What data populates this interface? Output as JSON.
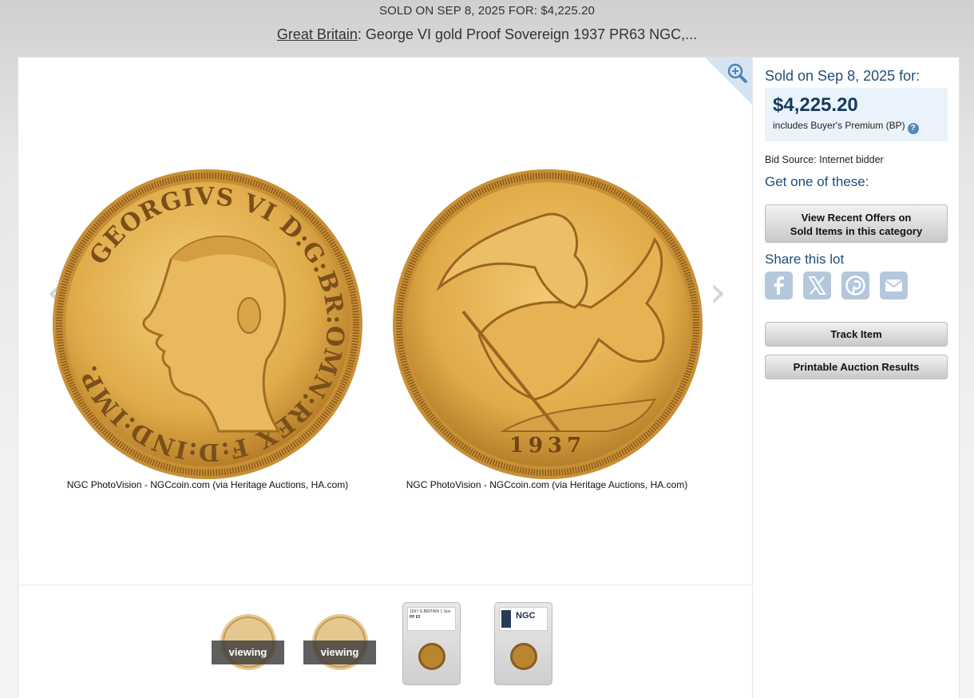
{
  "header": {
    "sold_line": "SOLD ON SEP 8, 2025 FOR: $4,225.20",
    "title_link": "Great Britain",
    "title_rest": ": George VI gold Proof Sovereign 1937 PR63 NGC,..."
  },
  "viewer": {
    "captions": [
      "NGC PhotoVision - NGCcoin.com (via Heritage Auctions, HA.com)",
      "NGC PhotoVision - NGCcoin.com (via Heritage Auctions, HA.com)"
    ],
    "obverse_legend": "GEORGIVS VI D:G:BR:OMN:REX F:D:IND:IMP.",
    "reverse_date": "1937",
    "prev_glyph": "‹",
    "next_glyph": "›"
  },
  "thumbnails": {
    "viewing_label": "viewing",
    "slab_label_1": "1937 G.BRITAIN 1 Sov",
    "slab_grade_1": "PF 63",
    "slab_label_2": "NGC"
  },
  "sidebar": {
    "sold_on": "Sold on Sep 8, 2025 for:",
    "price": "$4,225.20",
    "bp_note": "includes Buyer's Premium (BP)",
    "help": "?",
    "bid_source": "Bid Source: Internet bidder",
    "get_one": "Get one of these:",
    "offers_btn_line1": "View Recent Offers on",
    "offers_btn_line2": "Sold Items in this category",
    "share": "Share this lot",
    "track_btn": "Track Item",
    "print_btn": "Printable Auction Results"
  },
  "colors": {
    "accent_blue": "#1e4f7a",
    "price_bg": "#eaf3fb",
    "gold": "#d9a441"
  }
}
